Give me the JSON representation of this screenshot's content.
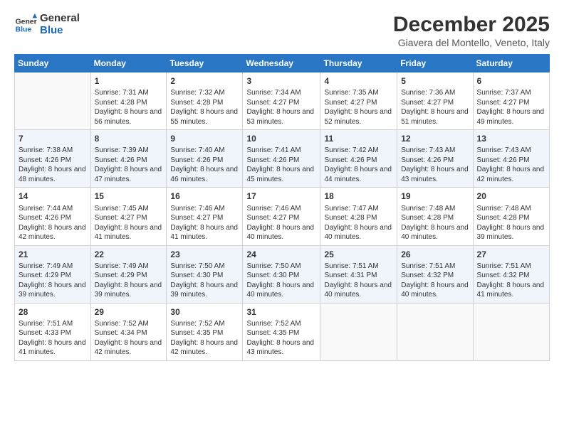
{
  "header": {
    "logo_line1": "General",
    "logo_line2": "Blue",
    "month": "December 2025",
    "location": "Giavera del Montello, Veneto, Italy"
  },
  "days_of_week": [
    "Sunday",
    "Monday",
    "Tuesday",
    "Wednesday",
    "Thursday",
    "Friday",
    "Saturday"
  ],
  "weeks": [
    [
      {
        "day": "",
        "sunrise": "",
        "sunset": "",
        "daylight": ""
      },
      {
        "day": "1",
        "sunrise": "Sunrise: 7:31 AM",
        "sunset": "Sunset: 4:28 PM",
        "daylight": "Daylight: 8 hours and 56 minutes."
      },
      {
        "day": "2",
        "sunrise": "Sunrise: 7:32 AM",
        "sunset": "Sunset: 4:28 PM",
        "daylight": "Daylight: 8 hours and 55 minutes."
      },
      {
        "day": "3",
        "sunrise": "Sunrise: 7:34 AM",
        "sunset": "Sunset: 4:27 PM",
        "daylight": "Daylight: 8 hours and 53 minutes."
      },
      {
        "day": "4",
        "sunrise": "Sunrise: 7:35 AM",
        "sunset": "Sunset: 4:27 PM",
        "daylight": "Daylight: 8 hours and 52 minutes."
      },
      {
        "day": "5",
        "sunrise": "Sunrise: 7:36 AM",
        "sunset": "Sunset: 4:27 PM",
        "daylight": "Daylight: 8 hours and 51 minutes."
      },
      {
        "day": "6",
        "sunrise": "Sunrise: 7:37 AM",
        "sunset": "Sunset: 4:27 PM",
        "daylight": "Daylight: 8 hours and 49 minutes."
      }
    ],
    [
      {
        "day": "7",
        "sunrise": "Sunrise: 7:38 AM",
        "sunset": "Sunset: 4:26 PM",
        "daylight": "Daylight: 8 hours and 48 minutes."
      },
      {
        "day": "8",
        "sunrise": "Sunrise: 7:39 AM",
        "sunset": "Sunset: 4:26 PM",
        "daylight": "Daylight: 8 hours and 47 minutes."
      },
      {
        "day": "9",
        "sunrise": "Sunrise: 7:40 AM",
        "sunset": "Sunset: 4:26 PM",
        "daylight": "Daylight: 8 hours and 46 minutes."
      },
      {
        "day": "10",
        "sunrise": "Sunrise: 7:41 AM",
        "sunset": "Sunset: 4:26 PM",
        "daylight": "Daylight: 8 hours and 45 minutes."
      },
      {
        "day": "11",
        "sunrise": "Sunrise: 7:42 AM",
        "sunset": "Sunset: 4:26 PM",
        "daylight": "Daylight: 8 hours and 44 minutes."
      },
      {
        "day": "12",
        "sunrise": "Sunrise: 7:43 AM",
        "sunset": "Sunset: 4:26 PM",
        "daylight": "Daylight: 8 hours and 43 minutes."
      },
      {
        "day": "13",
        "sunrise": "Sunrise: 7:43 AM",
        "sunset": "Sunset: 4:26 PM",
        "daylight": "Daylight: 8 hours and 42 minutes."
      }
    ],
    [
      {
        "day": "14",
        "sunrise": "Sunrise: 7:44 AM",
        "sunset": "Sunset: 4:26 PM",
        "daylight": "Daylight: 8 hours and 42 minutes."
      },
      {
        "day": "15",
        "sunrise": "Sunrise: 7:45 AM",
        "sunset": "Sunset: 4:27 PM",
        "daylight": "Daylight: 8 hours and 41 minutes."
      },
      {
        "day": "16",
        "sunrise": "Sunrise: 7:46 AM",
        "sunset": "Sunset: 4:27 PM",
        "daylight": "Daylight: 8 hours and 41 minutes."
      },
      {
        "day": "17",
        "sunrise": "Sunrise: 7:46 AM",
        "sunset": "Sunset: 4:27 PM",
        "daylight": "Daylight: 8 hours and 40 minutes."
      },
      {
        "day": "18",
        "sunrise": "Sunrise: 7:47 AM",
        "sunset": "Sunset: 4:28 PM",
        "daylight": "Daylight: 8 hours and 40 minutes."
      },
      {
        "day": "19",
        "sunrise": "Sunrise: 7:48 AM",
        "sunset": "Sunset: 4:28 PM",
        "daylight": "Daylight: 8 hours and 40 minutes."
      },
      {
        "day": "20",
        "sunrise": "Sunrise: 7:48 AM",
        "sunset": "Sunset: 4:28 PM",
        "daylight": "Daylight: 8 hours and 39 minutes."
      }
    ],
    [
      {
        "day": "21",
        "sunrise": "Sunrise: 7:49 AM",
        "sunset": "Sunset: 4:29 PM",
        "daylight": "Daylight: 8 hours and 39 minutes."
      },
      {
        "day": "22",
        "sunrise": "Sunrise: 7:49 AM",
        "sunset": "Sunset: 4:29 PM",
        "daylight": "Daylight: 8 hours and 39 minutes."
      },
      {
        "day": "23",
        "sunrise": "Sunrise: 7:50 AM",
        "sunset": "Sunset: 4:30 PM",
        "daylight": "Daylight: 8 hours and 39 minutes."
      },
      {
        "day": "24",
        "sunrise": "Sunrise: 7:50 AM",
        "sunset": "Sunset: 4:30 PM",
        "daylight": "Daylight: 8 hours and 40 minutes."
      },
      {
        "day": "25",
        "sunrise": "Sunrise: 7:51 AM",
        "sunset": "Sunset: 4:31 PM",
        "daylight": "Daylight: 8 hours and 40 minutes."
      },
      {
        "day": "26",
        "sunrise": "Sunrise: 7:51 AM",
        "sunset": "Sunset: 4:32 PM",
        "daylight": "Daylight: 8 hours and 40 minutes."
      },
      {
        "day": "27",
        "sunrise": "Sunrise: 7:51 AM",
        "sunset": "Sunset: 4:32 PM",
        "daylight": "Daylight: 8 hours and 41 minutes."
      }
    ],
    [
      {
        "day": "28",
        "sunrise": "Sunrise: 7:51 AM",
        "sunset": "Sunset: 4:33 PM",
        "daylight": "Daylight: 8 hours and 41 minutes."
      },
      {
        "day": "29",
        "sunrise": "Sunrise: 7:52 AM",
        "sunset": "Sunset: 4:34 PM",
        "daylight": "Daylight: 8 hours and 42 minutes."
      },
      {
        "day": "30",
        "sunrise": "Sunrise: 7:52 AM",
        "sunset": "Sunset: 4:35 PM",
        "daylight": "Daylight: 8 hours and 42 minutes."
      },
      {
        "day": "31",
        "sunrise": "Sunrise: 7:52 AM",
        "sunset": "Sunset: 4:35 PM",
        "daylight": "Daylight: 8 hours and 43 minutes."
      },
      {
        "day": "",
        "sunrise": "",
        "sunset": "",
        "daylight": ""
      },
      {
        "day": "",
        "sunrise": "",
        "sunset": "",
        "daylight": ""
      },
      {
        "day": "",
        "sunrise": "",
        "sunset": "",
        "daylight": ""
      }
    ]
  ]
}
